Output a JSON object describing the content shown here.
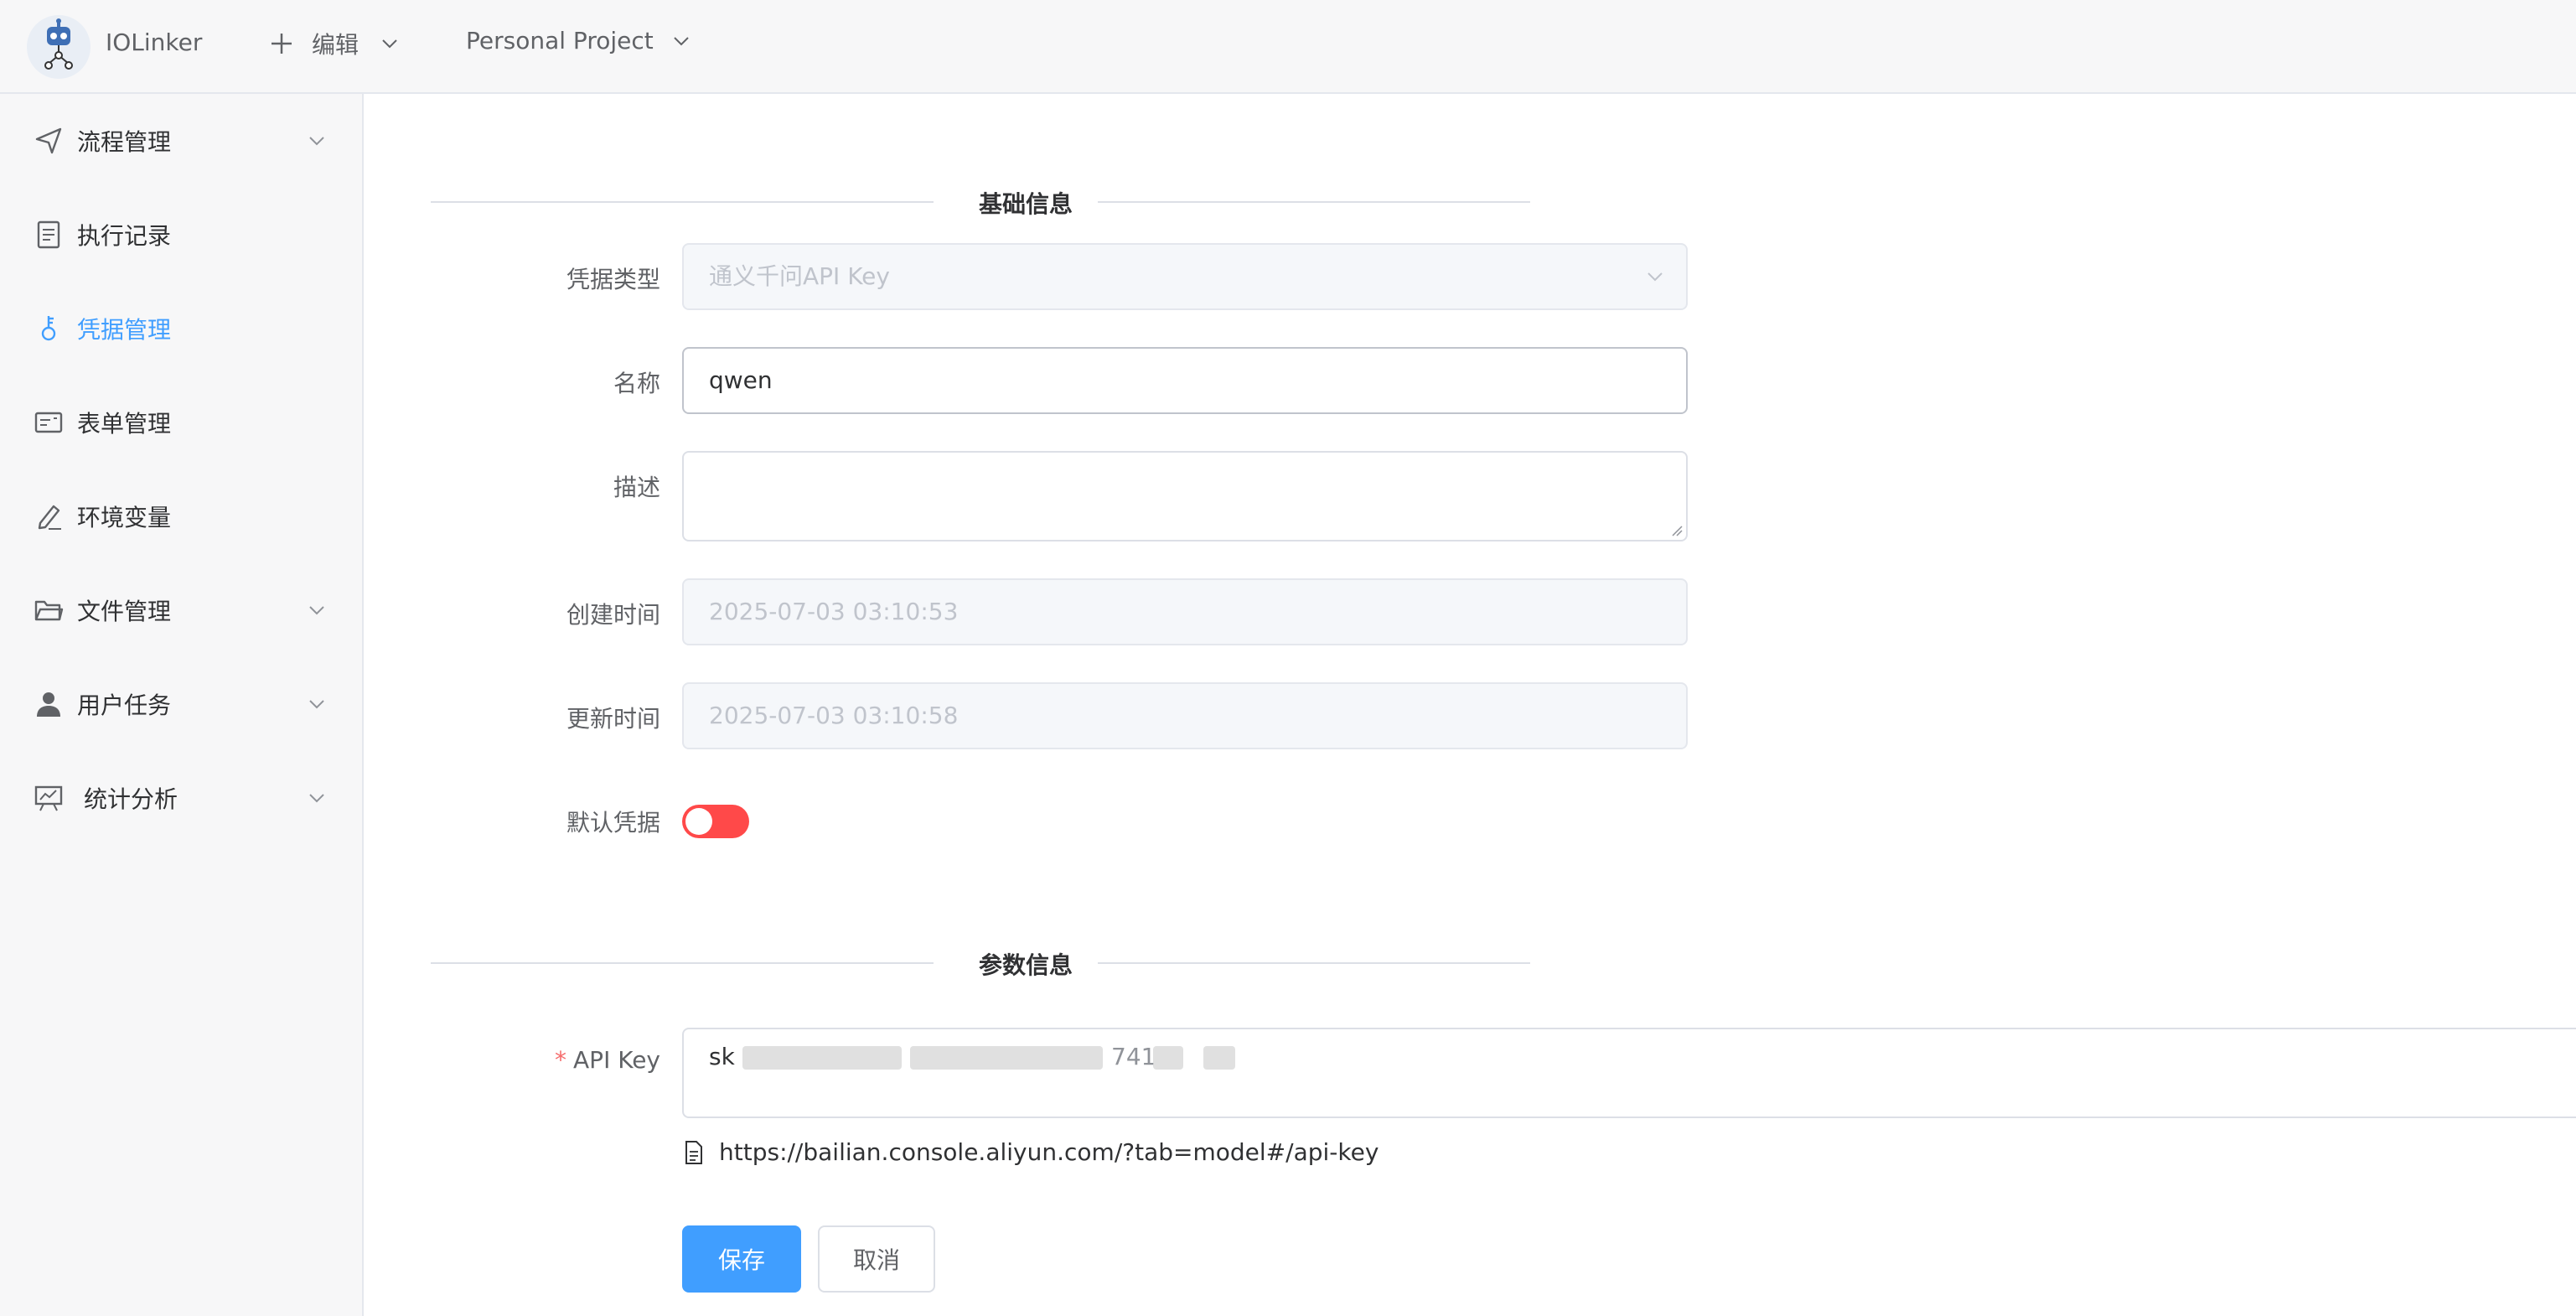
{
  "header": {
    "app_name": "IOLinker",
    "edit_label": "编辑",
    "project_label": "Personal Project"
  },
  "sidebar": {
    "items": [
      {
        "label": "流程管理",
        "icon": "send-icon",
        "expandable": true
      },
      {
        "label": "执行记录",
        "icon": "document-icon",
        "expandable": false
      },
      {
        "label": "凭据管理",
        "icon": "key-icon",
        "expandable": false,
        "active": true
      },
      {
        "label": "表单管理",
        "icon": "form-icon",
        "expandable": false
      },
      {
        "label": "环境变量",
        "icon": "edit-icon",
        "expandable": false
      },
      {
        "label": "文件管理",
        "icon": "folder-icon",
        "expandable": true
      },
      {
        "label": "用户任务",
        "icon": "user-icon",
        "expandable": true
      },
      {
        "label": "统计分析",
        "icon": "chart-icon",
        "expandable": true
      }
    ]
  },
  "form": {
    "section_basic": "基础信息",
    "section_params": "参数信息",
    "type_label": "凭据类型",
    "type_value": "通义千问API Key",
    "name_label": "名称",
    "name_value": "qwen",
    "desc_label": "描述",
    "desc_value": "",
    "created_label": "创建时间",
    "created_value": "2025-07-03 03:10:53",
    "updated_label": "更新时间",
    "updated_value": "2025-07-03 03:10:58",
    "default_label": "默认凭据",
    "default_on": false,
    "apikey_label": "API Key",
    "apikey_prefix": "sk",
    "apikey_visible_fragment": "741",
    "doc_url": "https://bailian.console.aliyun.com/?tab=model#/api-key",
    "save_label": "保存",
    "cancel_label": "取消"
  },
  "colors": {
    "accent": "#409eff",
    "switch_off": "#ff4949",
    "required": "#f56c6c"
  }
}
